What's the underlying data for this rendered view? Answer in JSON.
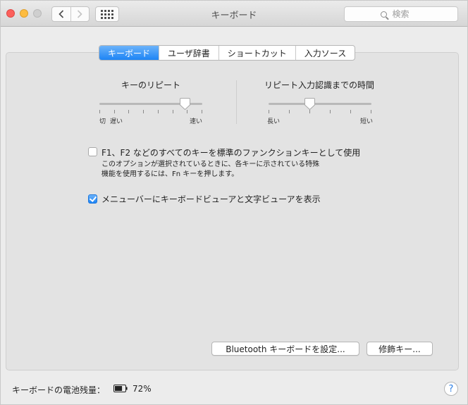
{
  "window": {
    "title": "キーボード"
  },
  "toolbar": {
    "back_icon": "chevron-left-icon",
    "forward_icon": "chevron-right-icon",
    "show_all_icon": "grid-icon",
    "search_placeholder": "検索"
  },
  "tabs": [
    {
      "label": "キーボード",
      "selected": true
    },
    {
      "label": "ユーザ辞書",
      "selected": false
    },
    {
      "label": "ショートカット",
      "selected": false
    },
    {
      "label": "入力ソース",
      "selected": false
    }
  ],
  "key_repeat": {
    "title": "キーのリピート",
    "label_left": "切",
    "label_slow": "遅い",
    "label_right": "速い",
    "value_fraction": 0.83
  },
  "delay_until_repeat": {
    "title": "リピート入力認識までの時間",
    "label_left": "長い",
    "label_right": "短い",
    "value_fraction": 0.4
  },
  "fn_keys": {
    "checked": false,
    "label": "F1、F2 などのすべてのキーを標準のファンクションキーとして使用",
    "desc_line1": "このオプションが選択されているときに、各キーに示されている特殊",
    "desc_line2": "機能を使用するには、Fn キーを押します。"
  },
  "menubar_viewer": {
    "checked": true,
    "label": "メニューバーにキーボードビューアと文字ビューアを表示"
  },
  "buttons": {
    "bluetooth": "Bluetooth キーボードを設定...",
    "modifier": "修飾キー..."
  },
  "footer": {
    "battery_label": "キーボードの電池残量：",
    "battery_icon": "battery-icon",
    "battery_percent": "72%",
    "battery_level": 0.72,
    "help_label": "?"
  },
  "colors": {
    "accent": "#1d84f5",
    "close": "#fc605c",
    "minimize": "#fdbc40"
  }
}
